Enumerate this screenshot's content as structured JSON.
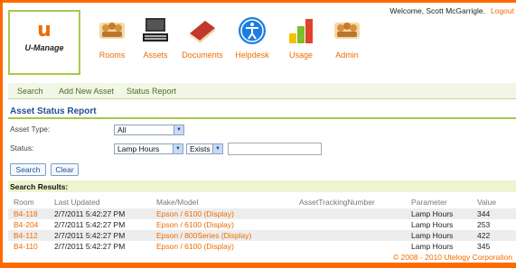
{
  "app": {
    "logo_letter": "u",
    "logo_name": "U-Manage"
  },
  "nav": [
    {
      "label": "Rooms",
      "icon": "rooms-icon"
    },
    {
      "label": "Assets",
      "icon": "computer-icon"
    },
    {
      "label": "Documents",
      "icon": "book-icon"
    },
    {
      "label": "Helpdesk",
      "icon": "accessibility-icon"
    },
    {
      "label": "Usage",
      "icon": "bar-chart-icon"
    },
    {
      "label": "Admin",
      "icon": "admin-icon"
    }
  ],
  "user": {
    "welcome": "Welcome, Scott McGarrigle.",
    "logout": "Logout"
  },
  "subnav": {
    "search": "Search",
    "add": "Add New Asset",
    "status": "Status Report"
  },
  "panel": {
    "title": "Asset Status Report",
    "asset_type_label": "Asset Type:",
    "asset_type_value": "All",
    "status_label": "Status:",
    "status_param_value": "Lamp Hours",
    "status_op_value": "Exists",
    "status_text_value": "",
    "search_button": "Search",
    "clear_button": "Clear"
  },
  "results": {
    "title": "Search Results:",
    "columns": {
      "room": "Room",
      "updated": "Last Updated",
      "make": "Make/Model",
      "tracking": "AssetTrackingNumber",
      "parameter": "Parameter",
      "value": "Value"
    },
    "rows": [
      {
        "room": "B4-118",
        "updated": "2/7/2011 5:42:27 PM",
        "make": "Epson / 6100 (Display)",
        "tracking": "",
        "parameter": "Lamp Hours",
        "value": "344"
      },
      {
        "room": "B4-204",
        "updated": "2/7/2011 5:42:27 PM",
        "make": "Epson / 6100 (Display)",
        "tracking": "",
        "parameter": "Lamp Hours",
        "value": "253"
      },
      {
        "room": "B4-112",
        "updated": "2/7/2011 5:42:27 PM",
        "make": "Epson / 800Series (Display)",
        "tracking": "",
        "parameter": "Lamp Hours",
        "value": "422"
      },
      {
        "room": "B4-110",
        "updated": "2/7/2011 5:42:27 PM",
        "make": "Epson / 6100 (Display)",
        "tracking": "",
        "parameter": "Lamp Hours",
        "value": "345"
      }
    ]
  },
  "footer": "© 2008 - 2010 Utelogy Corporation",
  "colors": {
    "brand_orange": "#ff6a00",
    "accent_green": "#a6c94a",
    "title_blue": "#1f4f95"
  }
}
